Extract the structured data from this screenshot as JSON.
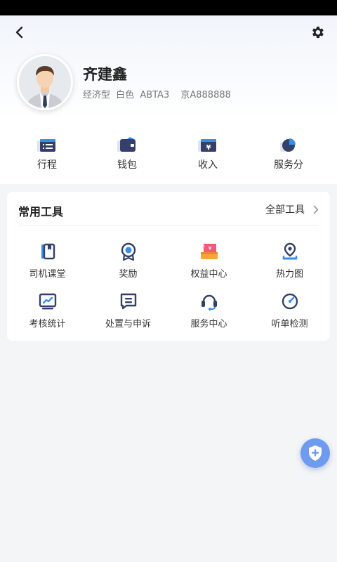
{
  "profile": {
    "name": "齐建鑫",
    "car_type": "经济型",
    "car_color": "白色",
    "car_model": "ABTA3",
    "plate": "京A888888"
  },
  "quick_actions": [
    {
      "label": "行程",
      "icon": "trip-list-icon"
    },
    {
      "label": "钱包",
      "icon": "wallet-icon"
    },
    {
      "label": "收入",
      "icon": "income-yuan-icon"
    },
    {
      "label": "服务分",
      "icon": "pie-chart-icon"
    }
  ],
  "tools": {
    "title": "常用工具",
    "all_label": "全部工具",
    "items": [
      {
        "label": "司机课堂",
        "icon": "book-icon"
      },
      {
        "label": "奖励",
        "icon": "medal-icon"
      },
      {
        "label": "权益中心",
        "icon": "gift-coupon-icon"
      },
      {
        "label": "热力图",
        "icon": "location-pin-icon"
      },
      {
        "label": "考核统计",
        "icon": "trend-chart-icon"
      },
      {
        "label": "处置与申诉",
        "icon": "message-icon"
      },
      {
        "label": "服务中心",
        "icon": "headset-icon"
      },
      {
        "label": "听单检测",
        "icon": "speedometer-icon"
      }
    ]
  },
  "colors": {
    "accent": "#3a8ee6",
    "navy": "#34406a",
    "fab": "#6f9bef",
    "page_bg": "#f4f5f7"
  }
}
